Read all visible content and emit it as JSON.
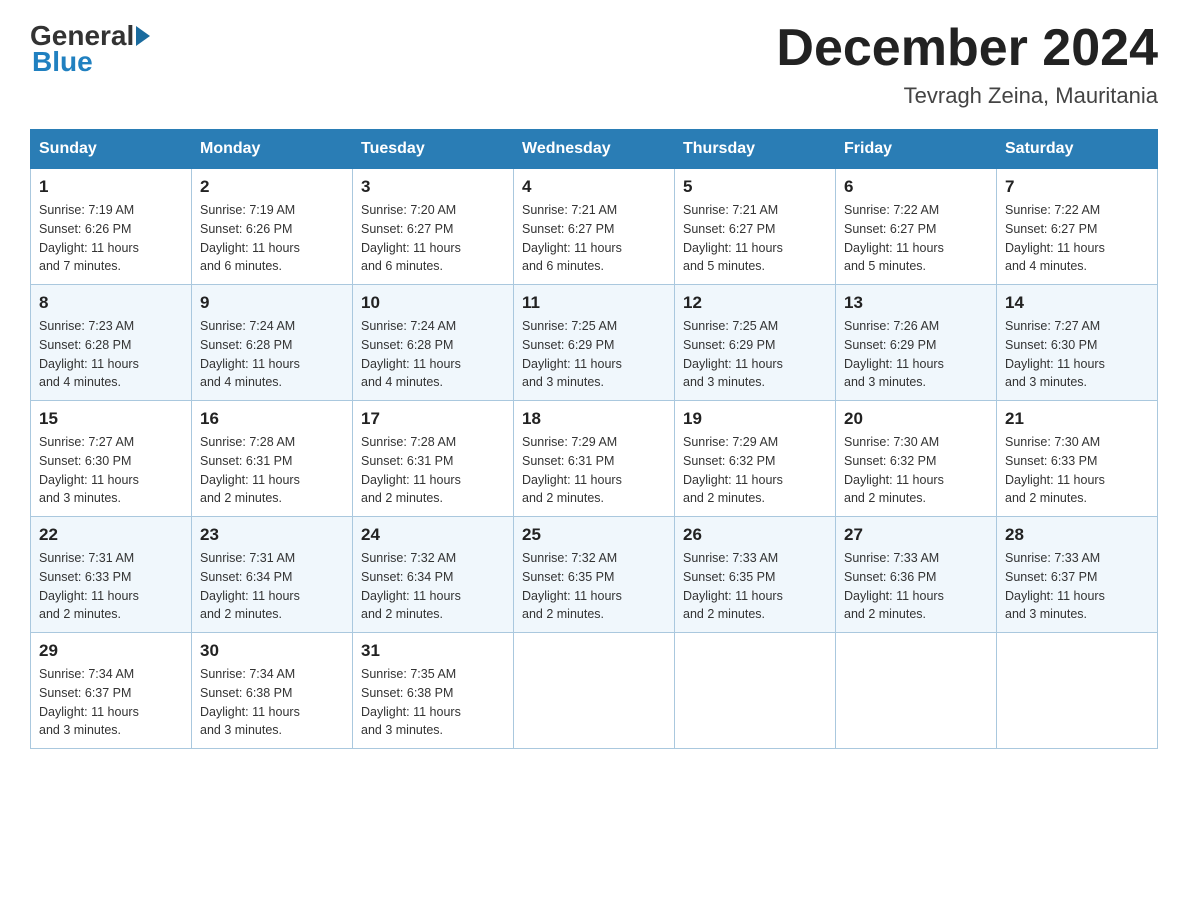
{
  "header": {
    "logo_general": "General",
    "logo_blue": "Blue",
    "month_title": "December 2024",
    "location": "Tevragh Zeina, Mauritania"
  },
  "days_of_week": [
    "Sunday",
    "Monday",
    "Tuesday",
    "Wednesday",
    "Thursday",
    "Friday",
    "Saturday"
  ],
  "weeks": [
    [
      {
        "day": "1",
        "sunrise": "7:19 AM",
        "sunset": "6:26 PM",
        "daylight": "11 hours and 7 minutes."
      },
      {
        "day": "2",
        "sunrise": "7:19 AM",
        "sunset": "6:26 PM",
        "daylight": "11 hours and 6 minutes."
      },
      {
        "day": "3",
        "sunrise": "7:20 AM",
        "sunset": "6:27 PM",
        "daylight": "11 hours and 6 minutes."
      },
      {
        "day": "4",
        "sunrise": "7:21 AM",
        "sunset": "6:27 PM",
        "daylight": "11 hours and 6 minutes."
      },
      {
        "day": "5",
        "sunrise": "7:21 AM",
        "sunset": "6:27 PM",
        "daylight": "11 hours and 5 minutes."
      },
      {
        "day": "6",
        "sunrise": "7:22 AM",
        "sunset": "6:27 PM",
        "daylight": "11 hours and 5 minutes."
      },
      {
        "day": "7",
        "sunrise": "7:22 AM",
        "sunset": "6:27 PM",
        "daylight": "11 hours and 4 minutes."
      }
    ],
    [
      {
        "day": "8",
        "sunrise": "7:23 AM",
        "sunset": "6:28 PM",
        "daylight": "11 hours and 4 minutes."
      },
      {
        "day": "9",
        "sunrise": "7:24 AM",
        "sunset": "6:28 PM",
        "daylight": "11 hours and 4 minutes."
      },
      {
        "day": "10",
        "sunrise": "7:24 AM",
        "sunset": "6:28 PM",
        "daylight": "11 hours and 4 minutes."
      },
      {
        "day": "11",
        "sunrise": "7:25 AM",
        "sunset": "6:29 PM",
        "daylight": "11 hours and 3 minutes."
      },
      {
        "day": "12",
        "sunrise": "7:25 AM",
        "sunset": "6:29 PM",
        "daylight": "11 hours and 3 minutes."
      },
      {
        "day": "13",
        "sunrise": "7:26 AM",
        "sunset": "6:29 PM",
        "daylight": "11 hours and 3 minutes."
      },
      {
        "day": "14",
        "sunrise": "7:27 AM",
        "sunset": "6:30 PM",
        "daylight": "11 hours and 3 minutes."
      }
    ],
    [
      {
        "day": "15",
        "sunrise": "7:27 AM",
        "sunset": "6:30 PM",
        "daylight": "11 hours and 3 minutes."
      },
      {
        "day": "16",
        "sunrise": "7:28 AM",
        "sunset": "6:31 PM",
        "daylight": "11 hours and 2 minutes."
      },
      {
        "day": "17",
        "sunrise": "7:28 AM",
        "sunset": "6:31 PM",
        "daylight": "11 hours and 2 minutes."
      },
      {
        "day": "18",
        "sunrise": "7:29 AM",
        "sunset": "6:31 PM",
        "daylight": "11 hours and 2 minutes."
      },
      {
        "day": "19",
        "sunrise": "7:29 AM",
        "sunset": "6:32 PM",
        "daylight": "11 hours and 2 minutes."
      },
      {
        "day": "20",
        "sunrise": "7:30 AM",
        "sunset": "6:32 PM",
        "daylight": "11 hours and 2 minutes."
      },
      {
        "day": "21",
        "sunrise": "7:30 AM",
        "sunset": "6:33 PM",
        "daylight": "11 hours and 2 minutes."
      }
    ],
    [
      {
        "day": "22",
        "sunrise": "7:31 AM",
        "sunset": "6:33 PM",
        "daylight": "11 hours and 2 minutes."
      },
      {
        "day": "23",
        "sunrise": "7:31 AM",
        "sunset": "6:34 PM",
        "daylight": "11 hours and 2 minutes."
      },
      {
        "day": "24",
        "sunrise": "7:32 AM",
        "sunset": "6:34 PM",
        "daylight": "11 hours and 2 minutes."
      },
      {
        "day": "25",
        "sunrise": "7:32 AM",
        "sunset": "6:35 PM",
        "daylight": "11 hours and 2 minutes."
      },
      {
        "day": "26",
        "sunrise": "7:33 AM",
        "sunset": "6:35 PM",
        "daylight": "11 hours and 2 minutes."
      },
      {
        "day": "27",
        "sunrise": "7:33 AM",
        "sunset": "6:36 PM",
        "daylight": "11 hours and 2 minutes."
      },
      {
        "day": "28",
        "sunrise": "7:33 AM",
        "sunset": "6:37 PM",
        "daylight": "11 hours and 3 minutes."
      }
    ],
    [
      {
        "day": "29",
        "sunrise": "7:34 AM",
        "sunset": "6:37 PM",
        "daylight": "11 hours and 3 minutes."
      },
      {
        "day": "30",
        "sunrise": "7:34 AM",
        "sunset": "6:38 PM",
        "daylight": "11 hours and 3 minutes."
      },
      {
        "day": "31",
        "sunrise": "7:35 AM",
        "sunset": "6:38 PM",
        "daylight": "11 hours and 3 minutes."
      },
      null,
      null,
      null,
      null
    ]
  ],
  "labels": {
    "sunrise": "Sunrise:",
    "sunset": "Sunset:",
    "daylight": "Daylight:"
  }
}
